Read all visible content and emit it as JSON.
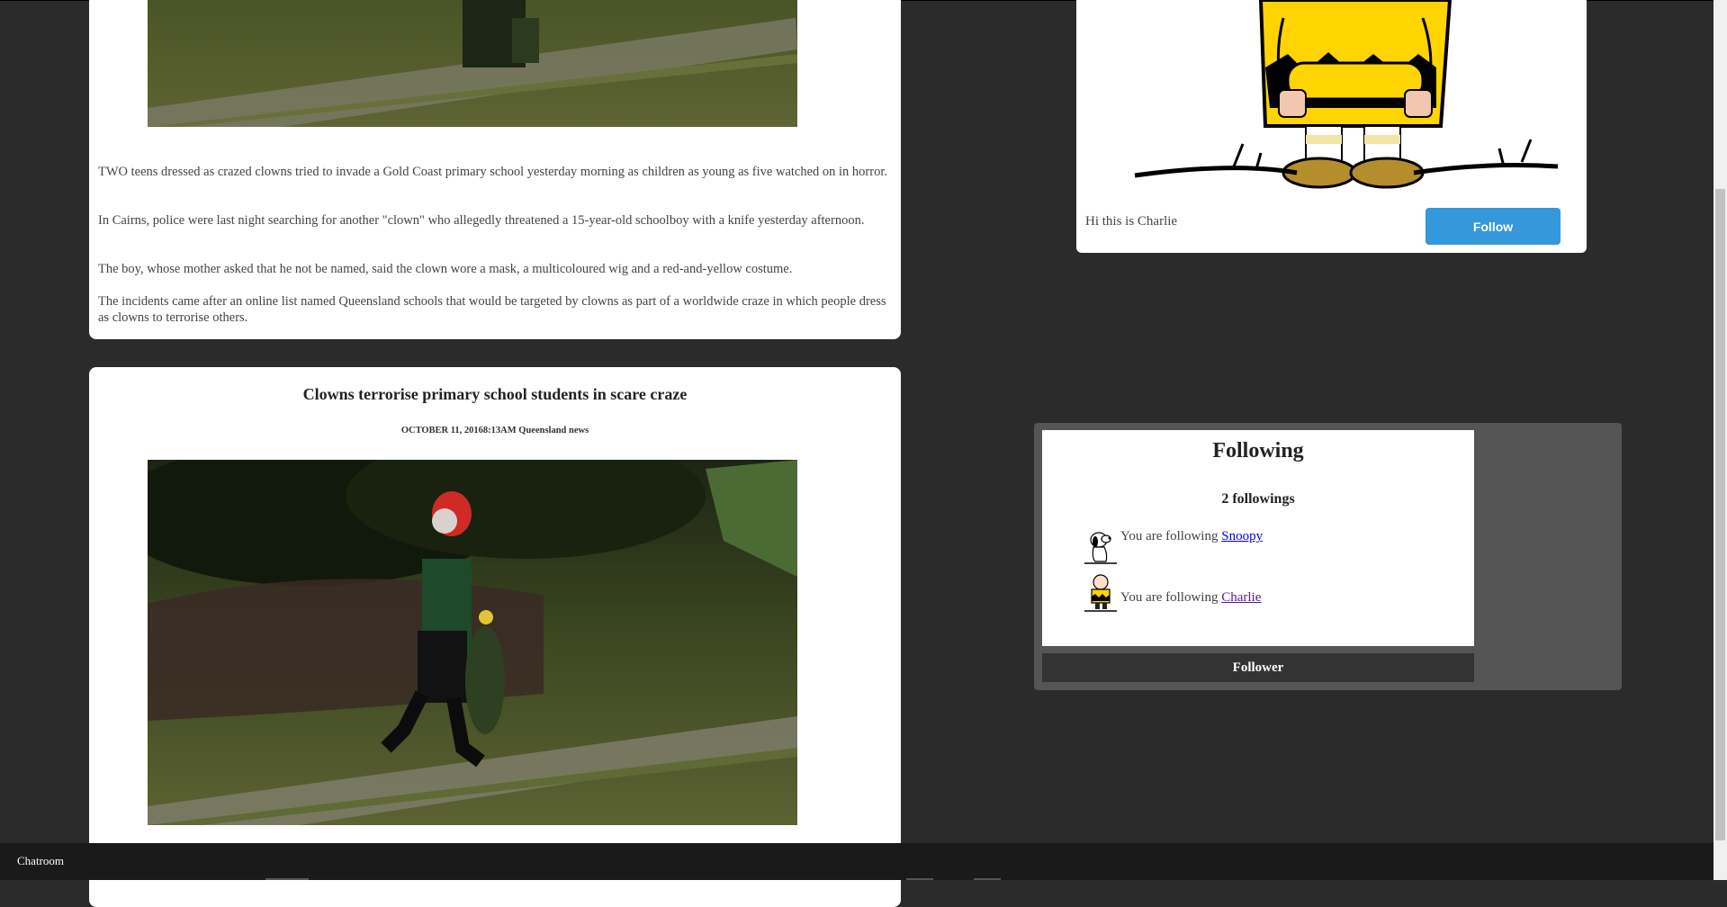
{
  "article_top": {
    "paragraphs": [
      "TWO teens dressed as crazed clowns tried to invade a Gold Coast primary school yesterday morning as children as young as five watched on in horror.",
      "In Cairns, police were last night searching for another \"clown\" who allegedly threatened a 15-year-old schoolboy with a knife yesterday afternoon.",
      "The boy, whose mother asked that he not be named, said the clown wore a mask, a multicoloured wig and a red-and-yellow costume.",
      "The incidents came after an online list named Queensland schools that would be targeted by clowns as part of a worldwide craze in which people dress as clowns to terrorise others."
    ]
  },
  "article_bottom": {
    "title": "Clowns terrorise primary school students in scare craze",
    "meta": "OCTOBER 11, 20168:13AM Queensland news"
  },
  "profile": {
    "bio": "Hi this is Charlie",
    "follow_label": "Follow"
  },
  "following": {
    "title": "Following",
    "count_label": "2 followings",
    "prefix": "You are following",
    "items": [
      {
        "name": "Snoopy",
        "icon": "snoopy-icon"
      },
      {
        "name": "Charlie",
        "icon": "charlie-brown-icon"
      }
    ],
    "follower_tab": "Follower"
  },
  "chatbar": {
    "label": "Chatroom"
  },
  "colors": {
    "accent": "#3498db",
    "page_bg": "#2b2b2b",
    "chatbar_bg": "#1a1a1a",
    "panel_bg": "#555555"
  }
}
